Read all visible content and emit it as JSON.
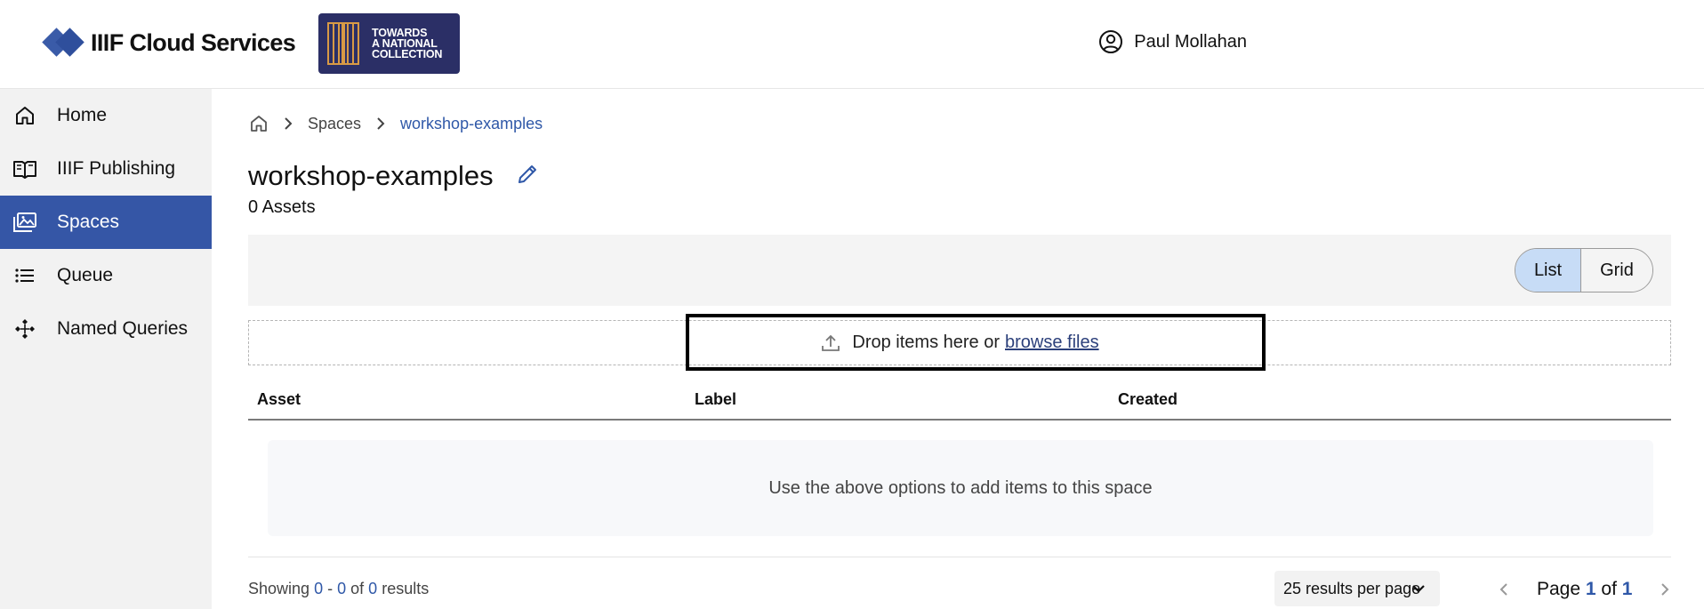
{
  "header": {
    "brand_name": "IIIF Cloud Services",
    "partner_logo": {
      "line1": "TOWARDS",
      "line2": "A NATIONAL",
      "line3": "COLLECTION"
    },
    "user_name": "Paul Mollahan"
  },
  "sidebar": {
    "items": [
      {
        "label": "Home",
        "icon": "home-icon"
      },
      {
        "label": "IIIF Publishing",
        "icon": "book-icon"
      },
      {
        "label": "Spaces",
        "icon": "images-icon",
        "active": true
      },
      {
        "label": "Queue",
        "icon": "list-icon"
      },
      {
        "label": "Named Queries",
        "icon": "network-icon"
      }
    ]
  },
  "breadcrumb": {
    "items": [
      "Spaces",
      "workshop-examples"
    ]
  },
  "page": {
    "title": "workshop-examples",
    "asset_count": "0 Assets"
  },
  "view_toggle": {
    "list": "List",
    "grid": "Grid",
    "selected": "List"
  },
  "dropzone": {
    "text": "Drop items here or",
    "link": "browse files"
  },
  "table": {
    "columns": [
      "Asset",
      "Label",
      "Created"
    ],
    "empty_message": "Use the above options to add items to this space"
  },
  "pagination": {
    "showing_prefix": "Showing",
    "start": "0",
    "dash": "-",
    "end": "0",
    "of": "of",
    "total": "0",
    "suffix": "results",
    "per_page": "25 results per page",
    "page_word": "Page",
    "current_page": "1",
    "of_word": "of",
    "total_pages": "1"
  },
  "colors": {
    "accent": "#3556a6",
    "link": "#2f58a8",
    "toggle_selected": "#c7dcf6"
  }
}
